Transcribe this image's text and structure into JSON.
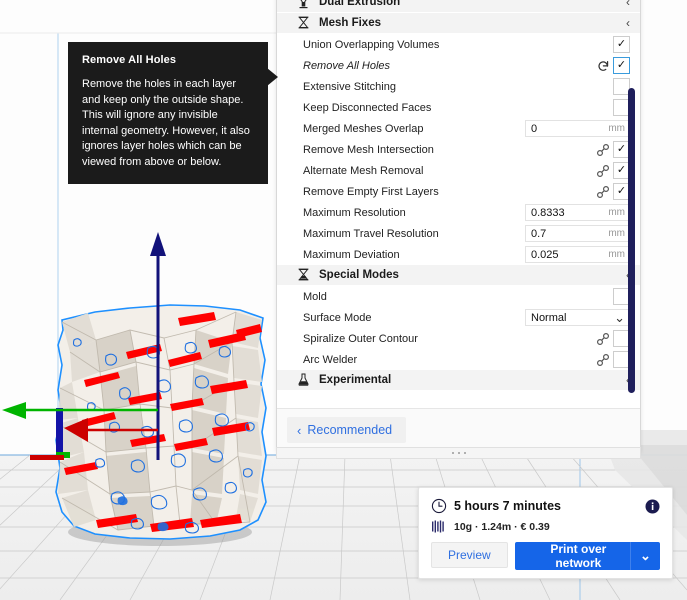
{
  "tooltip": {
    "title": "Remove All Holes",
    "body": "Remove the holes in each layer and keep only the outside shape. This will ignore any invisible internal geometry. However, it also ignores layer holes which can be viewed from above or below."
  },
  "settings_panel": {
    "categories": [
      {
        "id": "dual_extrusion",
        "label": "Dual Extrusion",
        "icon": "dual-extrusion-icon",
        "chevron": "‹"
      },
      {
        "id": "mesh_fixes",
        "label": "Mesh Fixes",
        "icon": "mesh-fixes-icon",
        "chevron": "‹"
      },
      {
        "id": "special_modes",
        "label": "Special Modes",
        "icon": "special-modes-icon",
        "chevron": "‹"
      },
      {
        "id": "experimental",
        "label": "Experimental",
        "icon": "experimental-icon",
        "chevron": "‹"
      }
    ],
    "mesh_fixes_rows": [
      {
        "label": "Union Overlapping Volumes",
        "control": "checkbox",
        "checked": true,
        "focused": false,
        "revert": false,
        "link": false
      },
      {
        "label": "Remove All Holes",
        "control": "checkbox",
        "checked": true,
        "focused": true,
        "revert": true,
        "link": false,
        "italic": true
      },
      {
        "label": "Extensive Stitching",
        "control": "checkbox",
        "checked": false,
        "focused": false,
        "revert": false,
        "link": false
      },
      {
        "label": "Keep Disconnected Faces",
        "control": "checkbox",
        "checked": false,
        "focused": false,
        "revert": false,
        "link": false
      },
      {
        "label": "Merged Meshes Overlap",
        "control": "value",
        "value": "0",
        "unit": "mm",
        "revert": false,
        "link": false
      },
      {
        "label": "Remove Mesh Intersection",
        "control": "checkbox",
        "checked": true,
        "focused": false,
        "revert": false,
        "link": true
      },
      {
        "label": "Alternate Mesh Removal",
        "control": "checkbox",
        "checked": true,
        "focused": false,
        "revert": false,
        "link": true
      },
      {
        "label": "Remove Empty First Layers",
        "control": "checkbox",
        "checked": true,
        "focused": false,
        "revert": false,
        "link": true
      },
      {
        "label": "Maximum Resolution",
        "control": "value",
        "value": "0.8333",
        "unit": "mm",
        "revert": false,
        "link": false
      },
      {
        "label": "Maximum Travel Resolution",
        "control": "value",
        "value": "0.7",
        "unit": "mm",
        "revert": false,
        "link": false
      },
      {
        "label": "Maximum Deviation",
        "control": "value",
        "value": "0.025",
        "unit": "mm",
        "revert": false,
        "link": false
      }
    ],
    "special_modes_rows": [
      {
        "label": "Mold",
        "control": "checkbox",
        "checked": false,
        "focused": false,
        "revert": false,
        "link": false
      },
      {
        "label": "Surface Mode",
        "control": "select",
        "value": "Normal",
        "revert": false,
        "link": false
      },
      {
        "label": "Spiralize Outer Contour",
        "control": "checkbox",
        "checked": false,
        "focused": false,
        "revert": false,
        "link": true
      },
      {
        "label": "Arc Welder",
        "control": "checkbox",
        "checked": false,
        "focused": false,
        "revert": false,
        "link": true
      }
    ],
    "footer": {
      "recommended_label": "Recommended",
      "recommended_chevron": "‹"
    },
    "checkmark_glyph": "✓",
    "select_chevron": "⌄",
    "scrollbar_color": "#1f1f5c"
  },
  "print_card": {
    "time": "5 hours 7 minutes",
    "meta": "10g · 1.24m · € 0.39",
    "preview_label": "Preview",
    "print_label": "Print over network",
    "print_dropdown_chevron": "⌄",
    "clock_icon": "clock-icon",
    "info_icon": "info-icon",
    "material_icon": "material-spool-icon",
    "accent_color": "#1565e8"
  },
  "viewport": {
    "axis_x_color": "#d40000",
    "axis_y_color": "#00b400",
    "axis_z_color": "#0000a0",
    "selection_outline_color": "#1e90ff",
    "overhang_color": "#ff0000",
    "model_name": "voronoi-vase-model"
  }
}
